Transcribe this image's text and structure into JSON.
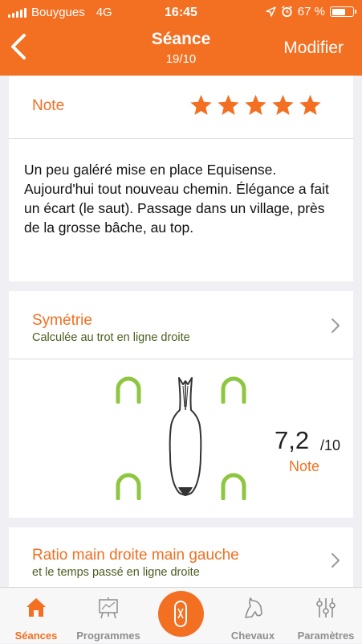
{
  "status": {
    "carrier": "Bouygues",
    "network": "4G",
    "time": "16:45",
    "battery": "67 %",
    "battery_level": 0.67
  },
  "nav": {
    "title": "Séance",
    "subtitle": "19/10",
    "action": "Modifier",
    "back_icon": "chevron-left-icon"
  },
  "rating": {
    "label": "Note",
    "stars": 5,
    "max": 5
  },
  "comment": "Un peu galéré mise en place Equisense. Aujourd'hui tout nouveau chemin. Élégance a fait un écart (le saut). Passage dans un village, près de la grosse bâche, au top.",
  "symmetry": {
    "title": "Symétrie",
    "subtitle": "Calculée au trot en ligne droite",
    "score": "7,2",
    "max": "/10",
    "score_label": "Note"
  },
  "ratio": {
    "title": "Ratio main droite main gauche",
    "subtitle": "et le temps passé en ligne droite"
  },
  "tabs": [
    {
      "label": "Séances",
      "icon": "home-icon",
      "active": true
    },
    {
      "label": "Programmes",
      "icon": "board-icon",
      "active": false
    },
    {
      "label": "",
      "icon": "sensor-icon",
      "active": false
    },
    {
      "label": "Chevaux",
      "icon": "horse-head-icon",
      "active": false
    },
    {
      "label": "Paramètres",
      "icon": "sliders-icon",
      "active": false
    }
  ],
  "colors": {
    "accent": "#f36f21",
    "horseshoe": "#8dc63f",
    "subtitle": "#4a5e20"
  }
}
